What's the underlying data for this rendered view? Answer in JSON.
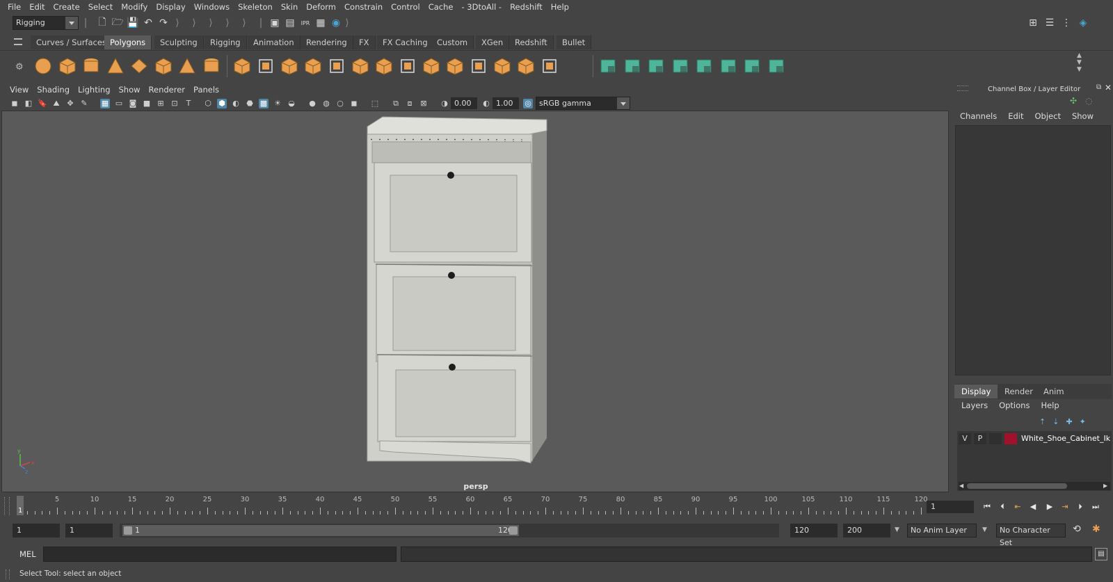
{
  "menubar": [
    "File",
    "Edit",
    "Create",
    "Select",
    "Modify",
    "Display",
    "Windows",
    "Skeleton",
    "Skin",
    "Deform",
    "Constrain",
    "Control",
    "Cache",
    "- 3DtoAll -",
    "Redshift",
    "Help"
  ],
  "status_line": {
    "menu_set": "Rigging"
  },
  "shelf": {
    "tabs": [
      "Curves / Surfaces",
      "Polygons",
      "Sculpting",
      "Rigging",
      "Animation",
      "Rendering",
      "FX",
      "FX Caching",
      "Custom",
      "XGen",
      "Redshift",
      "Bullet"
    ],
    "active_tab": "Polygons",
    "icons": [
      "sphere-icon",
      "cube-icon",
      "cylinder-icon",
      "cone-icon",
      "plane-icon",
      "torus-icon",
      "pyramid-icon",
      "pipe-icon",
      "combine-icon",
      "separate-icon",
      "extract-icon",
      "smooth-icon",
      "mirror-icon",
      "boolean-icon",
      "bevel-icon",
      "multicut-icon",
      "target-weld-icon",
      "bridge-icon",
      "extrude-icon",
      "append-icon",
      "fill-hole-icon",
      "merge-icon",
      "uv-map-icon",
      "planar-map-icon",
      "cylindrical-map-icon",
      "spherical-map-icon",
      "automatic-map-icon",
      "sew-uv-icon",
      "uv-editor-icon",
      "symmetry-icon"
    ]
  },
  "viewport": {
    "menu": [
      "View",
      "Shading",
      "Lighting",
      "Show",
      "Renderer",
      "Panels"
    ],
    "exposure": "0.00",
    "gamma": "1.00",
    "color_space": "sRGB gamma",
    "camera_label": "persp",
    "axis_labels": {
      "x": "x",
      "y": "y",
      "z": "z"
    }
  },
  "channel_box": {
    "title": "Channel Box / Layer Editor",
    "menu": [
      "Channels",
      "Edit",
      "Object",
      "Show"
    ]
  },
  "layer_editor": {
    "tabs": [
      "Display",
      "Render",
      "Anim"
    ],
    "active_tab": "Display",
    "menu": [
      "Layers",
      "Options",
      "Help"
    ],
    "layers": [
      {
        "visible": "V",
        "playback": "P",
        "color": "#a0122c",
        "name": "White_Shoe_Cabinet_Ikea"
      }
    ]
  },
  "time_slider": {
    "labels": [
      "5",
      "10",
      "15",
      "20",
      "25",
      "30",
      "35",
      "40",
      "45",
      "50",
      "55",
      "60",
      "65",
      "70",
      "75",
      "80",
      "85",
      "90",
      "95",
      "100",
      "105",
      "110",
      "115",
      "120"
    ],
    "start_label": "1",
    "current_frame": "1",
    "range": {
      "start": 0,
      "end": 120
    }
  },
  "range_slider": {
    "start": "1",
    "playback_start": "1",
    "slider_start": "1",
    "slider_end": "120",
    "playback_end": "120",
    "end": "200",
    "anim_layer": "No Anim Layer",
    "character_set": "No Character Set"
  },
  "command_line": {
    "label": "MEL"
  },
  "help_line": {
    "text": "Select Tool: select an object"
  },
  "colors": {
    "accent": "#5285a6",
    "shelf_orange": "#e8a050",
    "shelf_teal": "#4fb59a"
  }
}
